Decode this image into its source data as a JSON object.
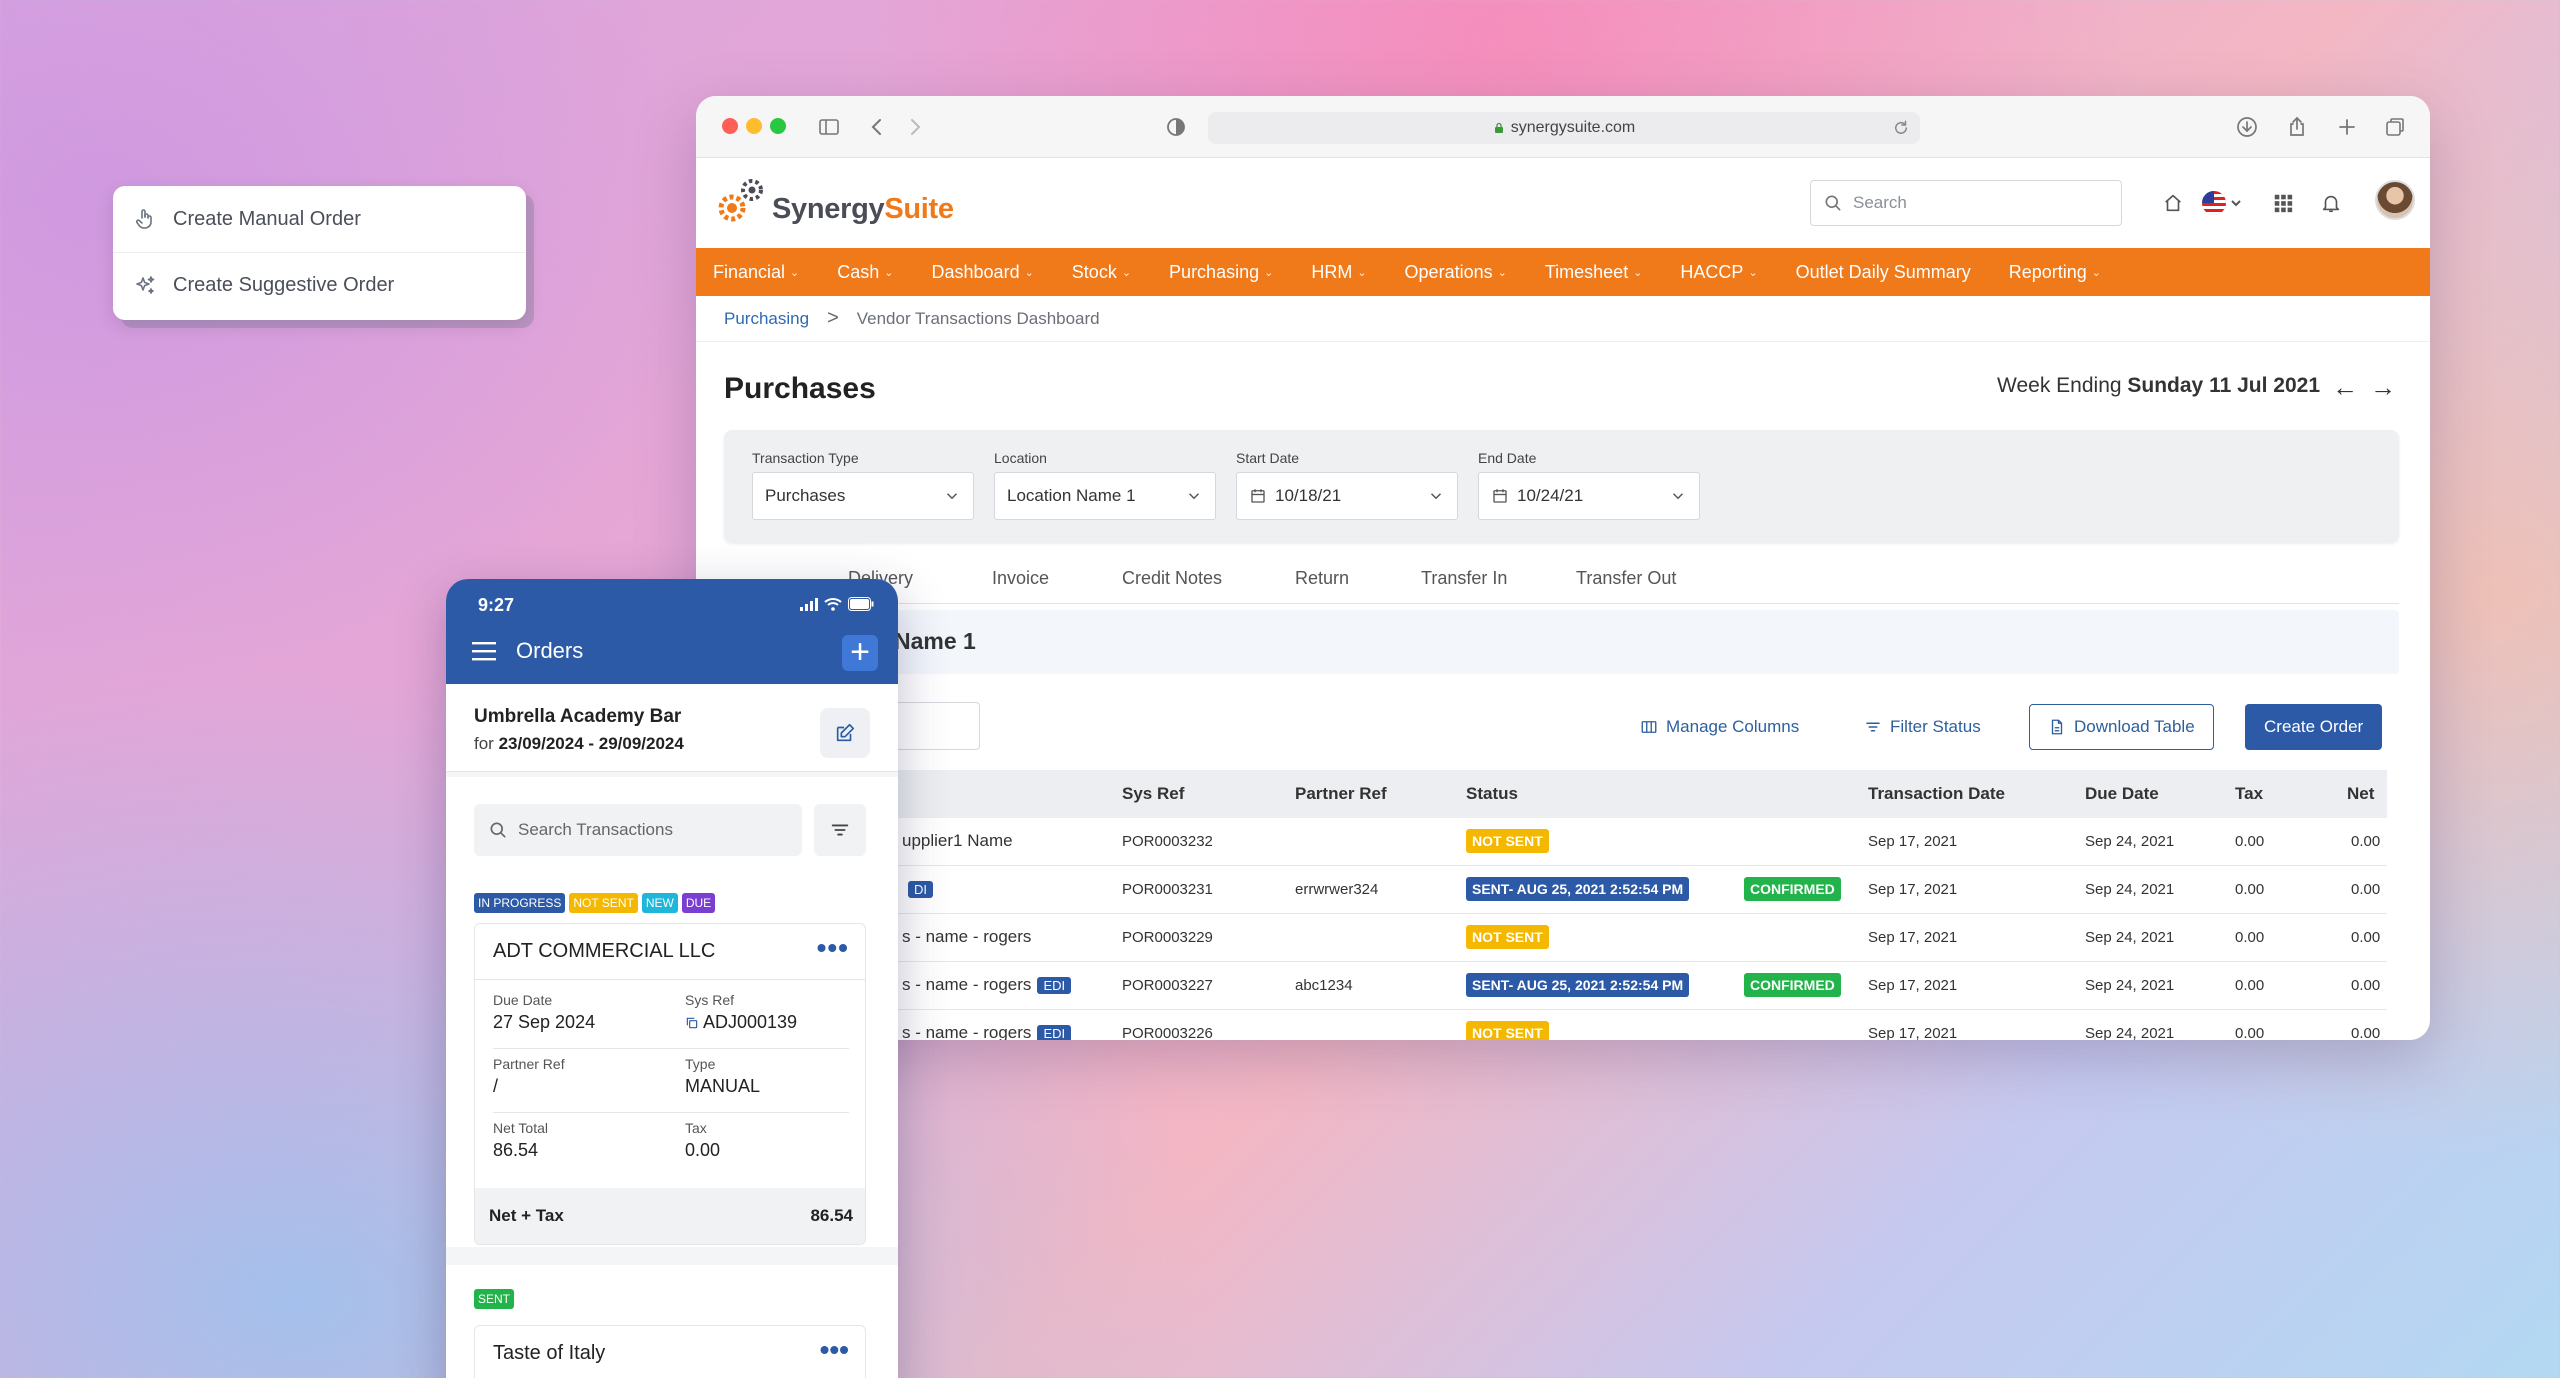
{
  "popup": {
    "items": [
      "Create Manual Order",
      "Create Suggestive Order"
    ]
  },
  "browser": {
    "url": "synergysuite.com",
    "logo": {
      "part1": "Synergy",
      "part2": "Suite"
    },
    "search_placeholder": "Search",
    "nav": [
      "Financial",
      "Cash",
      "Dashboard",
      "Stock",
      "Purchasing",
      "HRM",
      "Operations",
      "Timesheet",
      "HACCP",
      "Outlet Daily Summary",
      "Reporting"
    ],
    "nav_dropdown": [
      true,
      true,
      true,
      true,
      true,
      true,
      true,
      true,
      true,
      false,
      true
    ],
    "breadcrumb": {
      "parent": "Purchasing",
      "separator": ">",
      "current": "Vendor Transactions Dashboard"
    },
    "page_title": "Purchases",
    "week": {
      "prefix": "Week Ending ",
      "date": "Sunday 11 Jul 2021",
      "prev": "←",
      "next": "→"
    },
    "filters": {
      "transaction_type": {
        "label": "Transaction Type",
        "value": "Purchases"
      },
      "location": {
        "label": "Location",
        "value": "Location Name 1"
      },
      "start_date": {
        "label": "Start Date",
        "value": "10/18/21"
      },
      "end_date": {
        "label": "End Date",
        "value": "10/24/21"
      }
    },
    "tabs": [
      "Delivery",
      "Invoice",
      "Credit Notes",
      "Return",
      "Transfer In",
      "Transfer Out"
    ],
    "group_title": "Name 1",
    "toolbar": {
      "manage_columns": "Manage Columns",
      "filter_status": "Filter Status",
      "download_table": "Download Table",
      "create_order": "Create Order"
    },
    "table": {
      "headers": [
        "Sys Ref",
        "Partner Ref",
        "Status",
        "Transaction Date",
        "Due Date",
        "Tax",
        "Net"
      ],
      "rows": [
        {
          "vendor": "upplier1 Name",
          "edi": "",
          "sys_ref": "POR0003232",
          "partner_ref": "",
          "status": "NOT SENT",
          "status_color": "yellow",
          "extra": "",
          "tdate": "Sep 17, 2021",
          "due": "Sep 24, 2021",
          "tax": "0.00",
          "net": "0.00"
        },
        {
          "vendor": "",
          "edi": "DI",
          "sys_ref": "POR0003231",
          "partner_ref": "errwrwer324",
          "status": "SENT- AUG 25, 2021 2:52:54 PM",
          "status_color": "blue",
          "extra": "CONFIRMED",
          "tdate": "Sep 17, 2021",
          "due": "Sep 24, 2021",
          "tax": "0.00",
          "net": "0.00"
        },
        {
          "vendor": "s - name - rogers",
          "edi": "",
          "sys_ref": "POR0003229",
          "partner_ref": "",
          "status": "NOT SENT",
          "status_color": "yellow",
          "extra": "",
          "tdate": "Sep 17, 2021",
          "due": "Sep 24, 2021",
          "tax": "0.00",
          "net": "0.00"
        },
        {
          "vendor": "s - name - rogers",
          "edi": "EDI",
          "sys_ref": "POR0003227",
          "partner_ref": "abc1234",
          "status": "SENT- AUG 25, 2021 2:52:54 PM",
          "status_color": "blue",
          "extra": "CONFIRMED",
          "tdate": "Sep 17, 2021",
          "due": "Sep 24, 2021",
          "tax": "0.00",
          "net": "0.00"
        },
        {
          "vendor": "s - name - rogers",
          "edi": "EDI",
          "sys_ref": "POR0003226",
          "partner_ref": "",
          "status": "NOT SENT",
          "status_color": "yellow",
          "extra": "",
          "tdate": "Sep 17, 2021",
          "due": "Sep 24, 2021",
          "tax": "0.00",
          "net": "0.00"
        }
      ]
    }
  },
  "phone": {
    "time": "9:27",
    "title": "Orders",
    "plus": "+",
    "vendor": {
      "name": "Umbrella Academy Bar",
      "for_label": "for ",
      "range": "23/09/2024 - 29/09/2024"
    },
    "search_placeholder": "Search Transactions",
    "badges": [
      {
        "text": "IN PROGRESS",
        "color": "blue"
      },
      {
        "text": "NOT SENT",
        "color": "yellow"
      },
      {
        "text": "NEW",
        "color": "cyan"
      },
      {
        "text": "DUE",
        "color": "purple"
      }
    ],
    "card": {
      "title": "ADT COMMERCIAL LLC",
      "menu": "•••",
      "due_date": {
        "label": "Due Date",
        "value": "27 Sep 2024"
      },
      "sys_ref": {
        "label": "Sys Ref",
        "value": "ADJ000139"
      },
      "partner_ref": {
        "label": "Partner Ref",
        "value": "/"
      },
      "type": {
        "label": "Type",
        "value": "MANUAL"
      },
      "net_total": {
        "label": "Net Total",
        "value": "86.54"
      },
      "tax": {
        "label": "Tax",
        "value": "0.00"
      },
      "net_tax": {
        "label": "Net + Tax",
        "value": "86.54"
      }
    },
    "card2": {
      "badge": "SENT",
      "title": "Taste of Italy",
      "menu": "•••"
    }
  }
}
